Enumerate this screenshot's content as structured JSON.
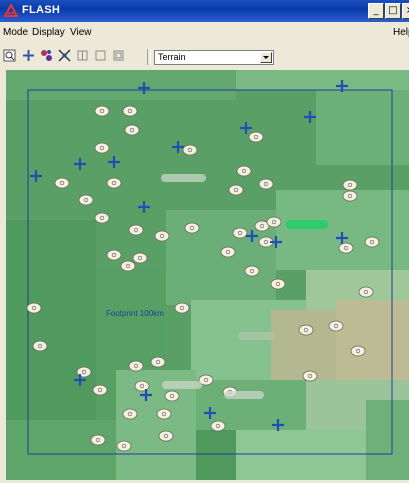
{
  "window": {
    "title": "FLASH",
    "buttons": {
      "minimize": "_",
      "maximize": "□",
      "close": "×"
    }
  },
  "menu": {
    "items": [
      "Mode",
      "Display",
      "View"
    ],
    "help": "Help"
  },
  "toolbar": {
    "tools": [
      {
        "name": "zoom-tool-icon"
      },
      {
        "name": "node-tool-icon"
      },
      {
        "name": "cluster-tool-icon"
      },
      {
        "name": "link-tool-icon"
      },
      {
        "name": "grid-tool-icon"
      },
      {
        "name": "box-tool-icon"
      },
      {
        "name": "frame-tool-icon"
      }
    ],
    "layer_select": {
      "value": "Terrain"
    }
  },
  "map": {
    "footprint_label": "Footprint 100km",
    "colors": {
      "terrain_dark": "#4f9a5c",
      "terrain_mid": "#6fb07a",
      "terrain_light": "#8cc594",
      "terrain_tan": "#b9b993",
      "boundary": "#1f3f9a",
      "cross": "#1f4fb5",
      "sensor": "#f3f0e0",
      "highlight": "#2ecc6b"
    }
  }
}
